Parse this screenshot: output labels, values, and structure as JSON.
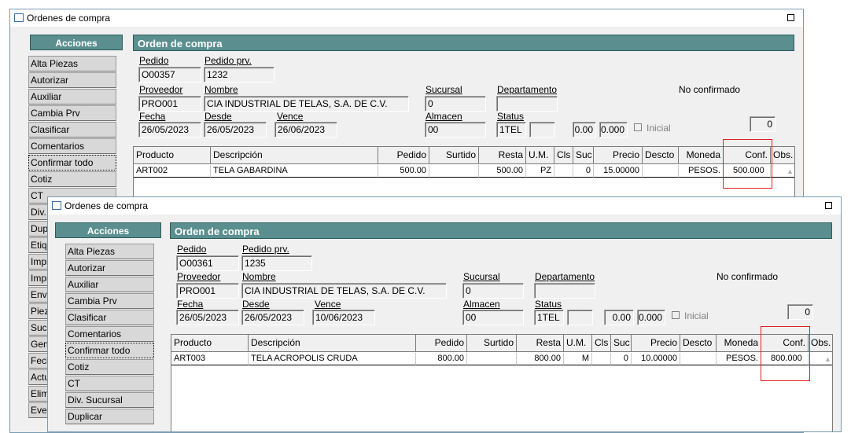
{
  "window_back": {
    "title": "Ordenes de compra",
    "acciones_label": "Acciones",
    "sidebar": [
      "Alta Piezas",
      "Autorizar",
      "Auxiliar",
      "Cambia Prv",
      "Clasificar",
      "Comentarios",
      "Confirmar todo",
      "Cotiz",
      "CT",
      "Div.",
      "Dup",
      "Etiq",
      "Impr",
      "Impr",
      "Envi",
      "Piez",
      "Sucu",
      "Gen",
      "Fech",
      "Actu",
      "Elim",
      "Ever"
    ],
    "header": "Orden de compra",
    "labels": {
      "pedido": "Pedido",
      "pedido_prv": "Pedido prv.",
      "proveedor": "Proveedor",
      "nombre": "Nombre",
      "sucursal": "Sucursal",
      "departamento": "Departamento",
      "fecha": "Fecha",
      "desde": "Desde",
      "vence": "Vence",
      "almacen": "Almacen",
      "status": "Status",
      "inicial": "Inicial"
    },
    "fields": {
      "pedido": "O00357",
      "pedido_prv": "1232",
      "proveedor": "PRO001",
      "nombre": "CIA INDUSTRIAL DE TELAS, S.A. DE C.V.",
      "sucursal": "0",
      "departamento": "",
      "fecha": "26/05/2023",
      "desde": "26/05/2023",
      "vence": "26/06/2023",
      "almacen": "00",
      "status": "1TEL",
      "status2": "",
      "val_a": "0.00",
      "val_b": "0.000",
      "count": "0"
    },
    "confirm_status": "No confirmado",
    "columns": [
      "Producto",
      "Descripción",
      "Pedido",
      "Surtido",
      "Resta",
      "U.M.",
      "Cls",
      "Suc",
      "Precio",
      "Descto",
      "Moneda",
      "Conf.",
      "Obs."
    ],
    "row": [
      "ART002",
      "TELA GABARDINA",
      "500.00",
      "",
      "500.00",
      "PZ",
      "",
      "0",
      "15.00000",
      "",
      "PESOS.",
      "500.000",
      ""
    ]
  },
  "window_front": {
    "title": "Ordenes de compra",
    "acciones_label": "Acciones",
    "sidebar": [
      "Alta Piezas",
      "Autorizar",
      "Auxiliar",
      "Cambia Prv",
      "Clasificar",
      "Comentarios",
      "Confirmar todo",
      "Cotiz",
      "CT",
      "Div. Sucursal",
      "Duplicar"
    ],
    "header": "Orden de compra",
    "labels": {
      "pedido": "Pedido",
      "pedido_prv": "Pedido prv.",
      "proveedor": "Proveedor",
      "nombre": "Nombre",
      "sucursal": "Sucursal",
      "departamento": "Departamento",
      "fecha": "Fecha",
      "desde": "Desde",
      "vence": "Vence",
      "almacen": "Almacen",
      "status": "Status",
      "inicial": "Inicial"
    },
    "fields": {
      "pedido": "O00361",
      "pedido_prv": "1235",
      "proveedor": "PRO001",
      "nombre": "CIA INDUSTRIAL DE TELAS, S.A. DE C.V.",
      "sucursal": "0",
      "departamento": "",
      "fecha": "26/05/2023",
      "desde": "26/05/2023",
      "vence": "10/06/2023",
      "almacen": "00",
      "status": "1TEL",
      "status2": "",
      "val_a": "0.00",
      "val_b": "0.000",
      "count": "0"
    },
    "confirm_status": "No confirmado",
    "columns": [
      "Producto",
      "Descripción",
      "Pedido",
      "Surtido",
      "Resta",
      "U.M.",
      "Cls",
      "Suc",
      "Precio",
      "Descto",
      "Moneda",
      "Conf.",
      "Obs."
    ],
    "row": [
      "ART003",
      "TELA ACROPOLIS CRUDA",
      "800.00",
      "",
      "800.00",
      "M",
      "",
      "0",
      "10.00000",
      "",
      "PESOS.",
      "800.000",
      ""
    ]
  },
  "colors": {
    "header_bg": "#5b8f8f",
    "highlight": "#e02020"
  }
}
